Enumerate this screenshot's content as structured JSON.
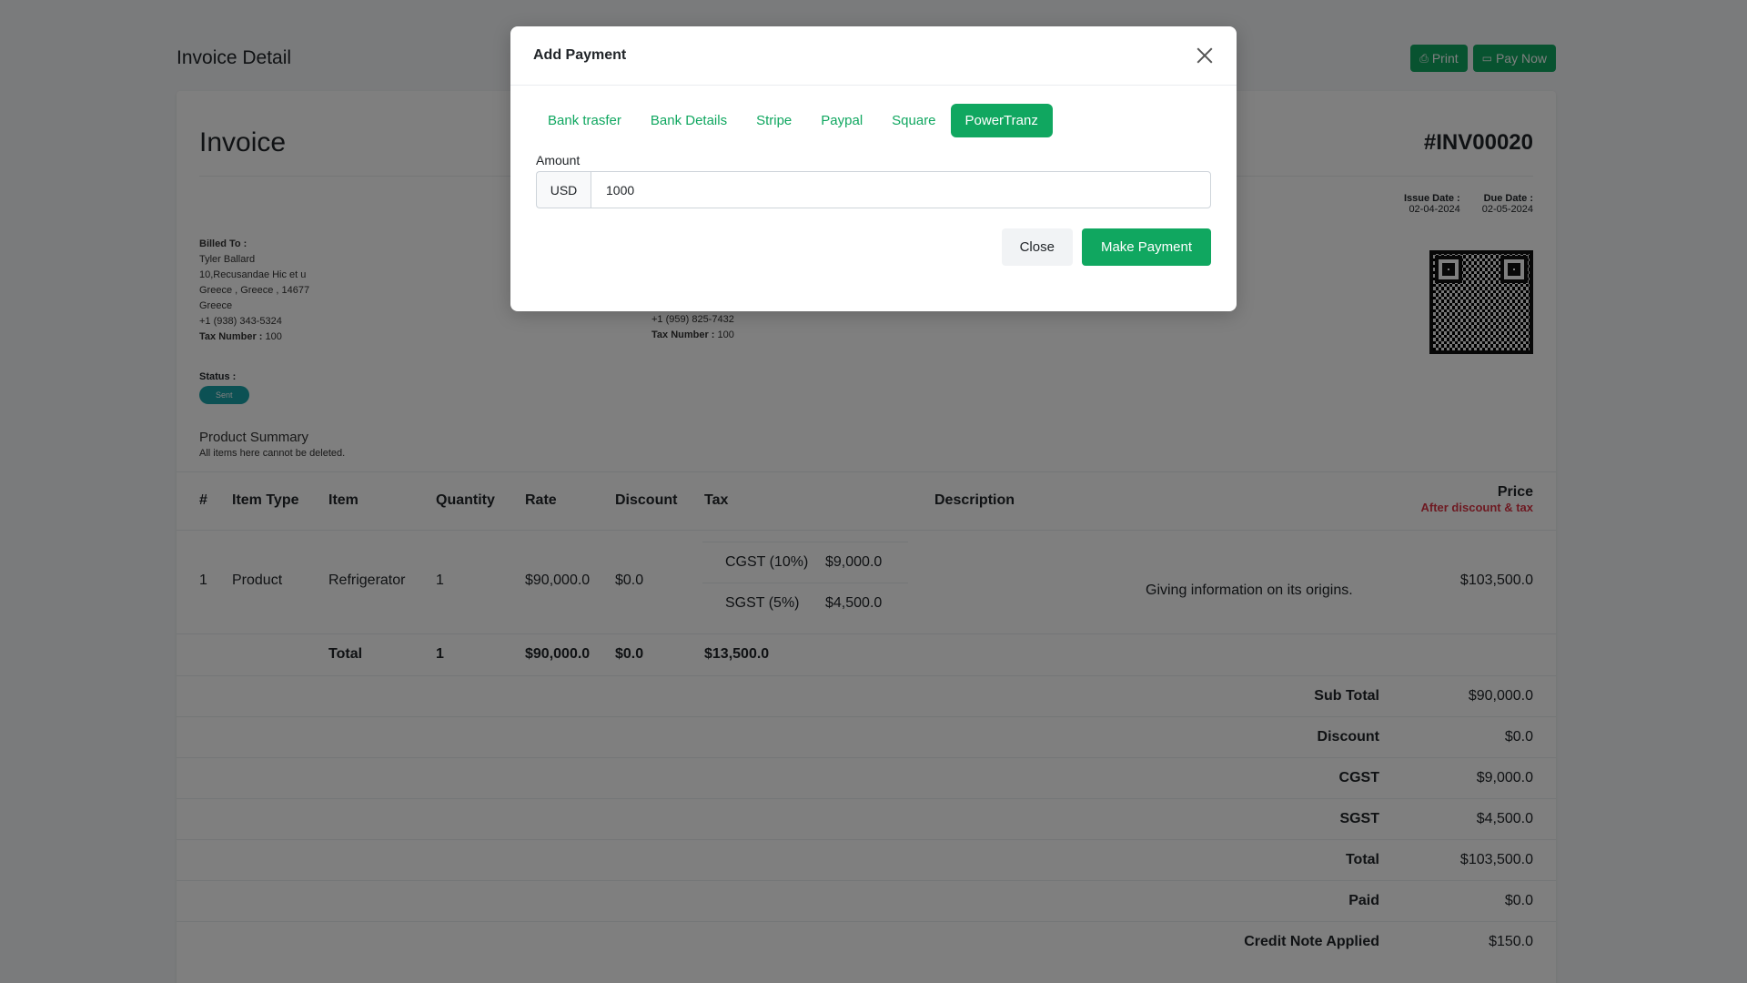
{
  "page": {
    "title": "Invoice Detail",
    "print_label": "Print",
    "pay_now_label": "Pay Now",
    "print_icon": "printer-icon",
    "pay_icon": "credit-card-icon"
  },
  "invoice": {
    "title": "Invoice",
    "number": "#INV00020",
    "issue_date_label": "Issue Date :",
    "issue_date": "02-04-2024",
    "due_date_label": "Due Date :",
    "due_date": "02-05-2024",
    "billed_to_label": "Billed To :",
    "billed_to": {
      "name": "Tyler Ballard",
      "address1": "10,Recusandae Hic et u",
      "address2": "Greece , Greece , 14677",
      "country": "Greece",
      "phone": "+1 (938) 343-5324",
      "tax_label": "Tax Number :",
      "tax_value": "100"
    },
    "billed_from": {
      "phone": "+1 (959) 825-7432",
      "tax_label": "Tax Number :",
      "tax_value": "100"
    },
    "status_label": "Status :",
    "status": "Sent",
    "product_summary_title": "Product Summary",
    "product_summary_note": "All items here cannot be deleted."
  },
  "table": {
    "headers": {
      "num": "#",
      "item_type": "Item Type",
      "item": "Item",
      "quantity": "Quantity",
      "rate": "Rate",
      "discount": "Discount",
      "tax": "Tax",
      "description": "Description",
      "price": "Price",
      "price_sub": "After discount & tax"
    },
    "rows": [
      {
        "num": "1",
        "item_type": "Product",
        "item": "Refrigerator",
        "quantity": "1",
        "rate": "$90,000.0",
        "discount": "$0.0",
        "taxes": [
          {
            "name": "CGST (10%)",
            "amount": "$9,000.0"
          },
          {
            "name": "SGST (5%)",
            "amount": "$4,500.0"
          }
        ],
        "description": "Giving information on its origins.",
        "price": "$103,500.0"
      }
    ],
    "total": {
      "label": "Total",
      "quantity": "1",
      "rate": "$90,000.0",
      "discount": "$0.0",
      "tax": "$13,500.0"
    }
  },
  "summary": [
    {
      "label": "Sub Total",
      "value": "$90,000.0"
    },
    {
      "label": "Discount",
      "value": "$0.0"
    },
    {
      "label": "CGST",
      "value": "$9,000.0"
    },
    {
      "label": "SGST",
      "value": "$4,500.0"
    },
    {
      "label": "Total",
      "value": "$103,500.0"
    },
    {
      "label": "Paid",
      "value": "$0.0"
    },
    {
      "label": "Credit Note Applied",
      "value": "$150.0"
    }
  ],
  "modal": {
    "title": "Add Payment",
    "tabs": [
      "Bank trasfer",
      "Bank Details",
      "Stripe",
      "Paypal",
      "Square",
      "PowerTranz"
    ],
    "active_tab": "PowerTranz",
    "amount_label": "Amount",
    "currency": "USD",
    "amount_value": "1000",
    "close_label": "Close",
    "submit_label": "Make Payment"
  },
  "colors": {
    "accent": "#10a760",
    "status_badge": "#19a2a8",
    "price_sub": "#dc3545"
  }
}
